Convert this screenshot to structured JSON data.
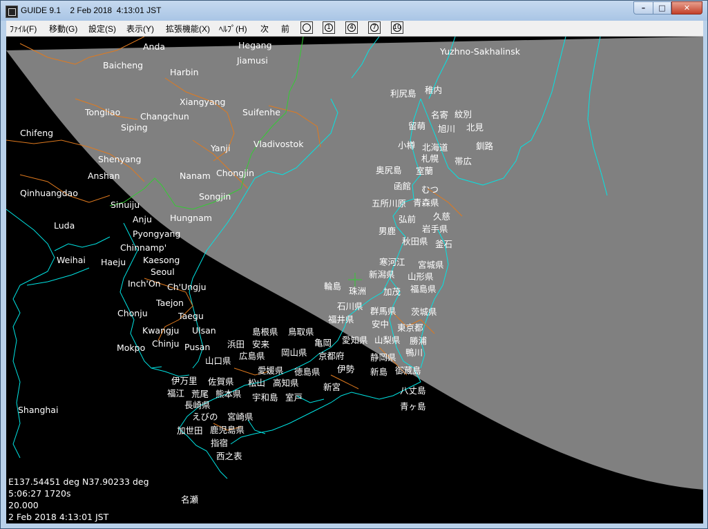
{
  "window": {
    "title": "GUIDE 9.1    2 Feb 2018  4:13:01 JST",
    "min_label": "–",
    "max_label": "□",
    "close_label": "✕",
    "icon": "app-icon"
  },
  "menu": {
    "items": [
      "ﾌｧｲﾙ(F)",
      "移動(G)",
      "設定(S)",
      "表示(Y)",
      "拡張機能(X)",
      "ﾍﾙﾌﾟ(H)",
      "次",
      "前"
    ],
    "tools": [
      {
        "icon": "clock-icon",
        "label": ""
      },
      {
        "icon": "one-icon",
        "label": "1"
      },
      {
        "icon": "four-icon",
        "label": "4"
      },
      {
        "icon": "seven-icon",
        "label": "7"
      },
      {
        "icon": "ten-icon",
        "label": "10"
      }
    ]
  },
  "map": {
    "colors": {
      "night": "#000000",
      "day": "#808080",
      "coast": "#00e5e5",
      "border": "#e07a1e",
      "green": "#33cc33"
    },
    "labels": [
      "Anda",
      "Hegang",
      "Baicheng",
      "Jiamusi",
      "Harbin",
      "Yuzhno-Sakhalinsk",
      "Xiangyang",
      "Tongliao",
      "Changchun",
      "Suifenhe",
      "Siping",
      "Chifeng",
      "Yanji",
      "Vladivostok",
      "Shenyang",
      "Anshan",
      "Nanam",
      "Chongjin",
      "Qinhuangdao",
      "Songjin",
      "Sinuiju",
      "Anju",
      "Hungnam",
      "Luda",
      "Pyongyang",
      "Chinnamp'",
      "Weihai",
      "Haeju",
      "Kaesong",
      "Seoul",
      "Inch'On",
      "Ch'Ungju",
      "Taejon",
      "Chonju",
      "Taegu",
      "Kwangju",
      "Ulsan",
      "Chinju",
      "Pusan",
      "Mokpo",
      "Shanghai",
      "利尻島",
      "稚内",
      "名寄",
      "紋別",
      "留萌",
      "旭川",
      "北見",
      "小樽",
      "北海道",
      "釧路",
      "札幌",
      "帯広",
      "奥尻島",
      "室蘭",
      "函館",
      "むつ",
      "五所川原",
      "青森県",
      "弘前",
      "久慈",
      "男鹿",
      "岩手県",
      "秋田県",
      "釜石",
      "寒河江",
      "宮城県",
      "新潟県",
      "山形県",
      "輪島",
      "珠洲",
      "加茂",
      "福島県",
      "石川県",
      "群馬県",
      "茨城県",
      "福井県",
      "安中",
      "東京都",
      "島根県",
      "鳥取県",
      "亀岡",
      "愛知県",
      "山梨県",
      "勝浦",
      "浜田",
      "安来",
      "京都府",
      "鴨川",
      "山口県",
      "広島県",
      "岡山県",
      "静岡県",
      "伊勢",
      "新島",
      "御蔵島",
      "徳島県",
      "愛媛県",
      "伊万里",
      "佐賀県",
      "松山",
      "高知県",
      "新宮",
      "福江",
      "荒尾",
      "熊本県",
      "宇和島",
      "室戸",
      "八丈島",
      "長崎県",
      "青ヶ島",
      "えびの",
      "宮崎県",
      "加世田",
      "鹿児島県",
      "指宿",
      "西之表",
      "名瀬"
    ],
    "readout": {
      "position": "E137.54451 deg N37.90233 deg",
      "time": " 5:06:27 1720s",
      "scale": "20.000",
      "datetime": " 2 Feb 2018  4:13:01 JST"
    }
  }
}
